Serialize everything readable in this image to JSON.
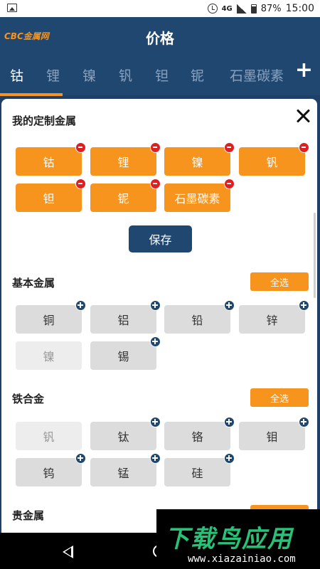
{
  "status_bar": {
    "network": "4G",
    "battery": "87%",
    "time": "15:00"
  },
  "header": {
    "logo": "CBC金属网",
    "title": "价格"
  },
  "tabs": [
    {
      "label": "钴",
      "active": true
    },
    {
      "label": "锂",
      "active": false
    },
    {
      "label": "镍",
      "active": false
    },
    {
      "label": "钒",
      "active": false
    },
    {
      "label": "钽",
      "active": false
    },
    {
      "label": "铌",
      "active": false
    },
    {
      "label": "石墨碳素",
      "active": false
    }
  ],
  "custom": {
    "title": "我的定制金属",
    "selected": [
      "钴",
      "锂",
      "镍",
      "钒",
      "钽",
      "铌",
      "石墨碳素"
    ],
    "save_label": "保存"
  },
  "groups": [
    {
      "title": "基本金属",
      "select_all": "全选",
      "items": [
        {
          "label": "铜",
          "state": "available"
        },
        {
          "label": "铝",
          "state": "available"
        },
        {
          "label": "铅",
          "state": "available"
        },
        {
          "label": "锌",
          "state": "available"
        },
        {
          "label": "镍",
          "state": "added"
        },
        {
          "label": "锡",
          "state": "available"
        }
      ]
    },
    {
      "title": "铁合金",
      "select_all": "全选",
      "items": [
        {
          "label": "钒",
          "state": "added"
        },
        {
          "label": "钛",
          "state": "available"
        },
        {
          "label": "铬",
          "state": "available"
        },
        {
          "label": "钼",
          "state": "available"
        },
        {
          "label": "钨",
          "state": "available"
        },
        {
          "label": "锰",
          "state": "available"
        },
        {
          "label": "硅",
          "state": "available"
        }
      ]
    },
    {
      "title": "贵金属"
    }
  ],
  "watermark": {
    "brand": "下载鸟应用",
    "url": "www.xiazainiao.com"
  }
}
